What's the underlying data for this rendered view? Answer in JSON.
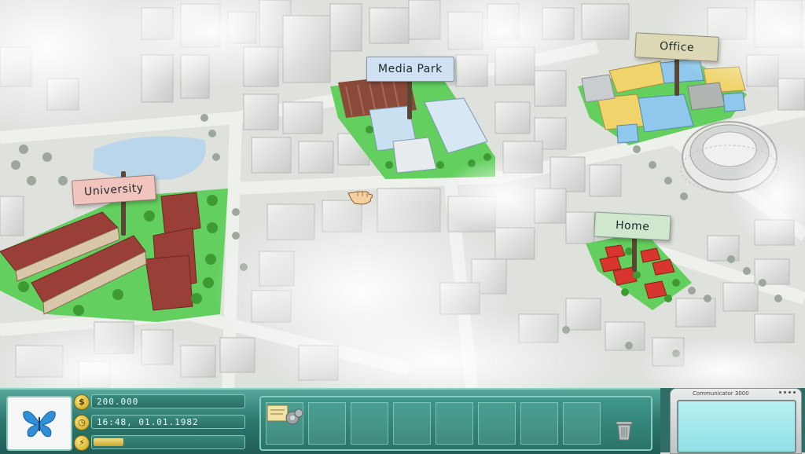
{
  "map": {
    "locations": [
      {
        "id": "university",
        "label": "University"
      },
      {
        "id": "media-park",
        "label": "Media Park"
      },
      {
        "id": "office",
        "label": "Office"
      },
      {
        "id": "home",
        "label": "Home"
      }
    ]
  },
  "hud": {
    "money": "200.000",
    "datetime": "16:48, 01.01.1982",
    "energy_fraction": 0.2,
    "icons": {
      "logo": "butterfly-icon",
      "money": "dollar-coin-icon",
      "clock": "clock-icon",
      "energy": "energy-icon",
      "inventory_item": "gears-document-icon",
      "trash": "trash-can-icon"
    },
    "inventory_slot_count": 8
  },
  "communicator": {
    "title": "Communicator 3000"
  },
  "colors": {
    "hud_teal": "#2d7a70",
    "grass": "#5fcf5a",
    "roof_red": "#a4403a",
    "roof_yellow": "#f0d36a",
    "roof_blue": "#8fc8ec"
  }
}
